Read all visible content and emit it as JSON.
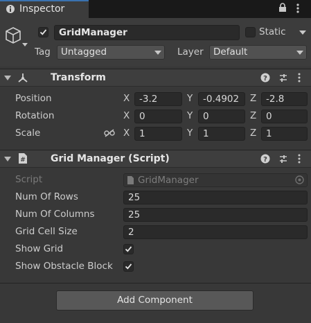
{
  "tab": {
    "title": "Inspector"
  },
  "object": {
    "name": "GridManager",
    "active": true,
    "static_label": "Static",
    "static": false,
    "tag_label": "Tag",
    "tag_value": "Untagged",
    "layer_label": "Layer",
    "layer_value": "Default"
  },
  "transform": {
    "title": "Transform",
    "rows": [
      {
        "label": "Position",
        "x": "-3.2",
        "y": "-0.4902",
        "z": "-2.8"
      },
      {
        "label": "Rotation",
        "x": "0",
        "y": "0",
        "z": "0"
      },
      {
        "label": "Scale",
        "x": "1",
        "y": "1",
        "z": "1"
      }
    ],
    "axis": {
      "x": "X",
      "y": "Y",
      "z": "Z"
    }
  },
  "script": {
    "title": "Grid Manager (Script)",
    "script_label": "Script",
    "script_value": "GridManager",
    "fields": [
      {
        "label": "Num Of Rows",
        "value": "25"
      },
      {
        "label": "Num Of Columns",
        "value": "25"
      },
      {
        "label": "Grid Cell Size",
        "value": "2"
      }
    ],
    "toggles": [
      {
        "label": "Show Grid",
        "checked": true
      },
      {
        "label": "Show Obstacle Block",
        "checked": true
      }
    ]
  },
  "footer": {
    "add_component": "Add Component"
  },
  "icons": [
    "inspector-icon",
    "lock-icon",
    "menu-icon",
    "cube-icon",
    "transform-icon",
    "script-file-icon",
    "help-icon",
    "preset-icon",
    "more-icon",
    "link-icon",
    "object-picker-icon"
  ]
}
